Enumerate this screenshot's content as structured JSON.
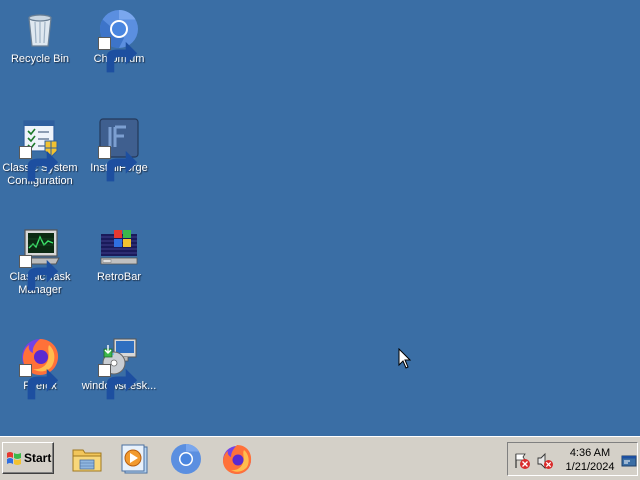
{
  "desktop": {
    "icons": [
      {
        "label": "Recycle Bin",
        "icon": "recycle-bin-icon"
      },
      {
        "label": "Chromium",
        "icon": "chromium-icon"
      },
      {
        "label": "Classic System Configuration",
        "icon": "system-configuration-icon"
      },
      {
        "label": "InstallForge",
        "icon": "installforge-icon"
      },
      {
        "label": "Classic Task Manager",
        "icon": "task-manager-icon"
      },
      {
        "label": "RetroBar",
        "icon": "retrobar-icon"
      },
      {
        "label": "Firefox",
        "icon": "firefox-icon"
      },
      {
        "label": "windowsdesk...",
        "icon": "installer-package-icon"
      }
    ]
  },
  "taskbar": {
    "start_label": "Start",
    "quick_launch": [
      {
        "icon": "file-explorer-icon"
      },
      {
        "icon": "media-player-icon"
      },
      {
        "icon": "chromium-icon"
      },
      {
        "icon": "firefox-icon"
      }
    ],
    "tray": {
      "icons": [
        "action-center-flag-icon",
        "volume-muted-icon"
      ],
      "time": "4:36 AM",
      "date": "1/21/2024",
      "show_desktop_icon": "show-desktop-icon"
    }
  },
  "colors": {
    "desktop_background": "#3a6ea5",
    "taskbar": "#d4d0c8"
  }
}
